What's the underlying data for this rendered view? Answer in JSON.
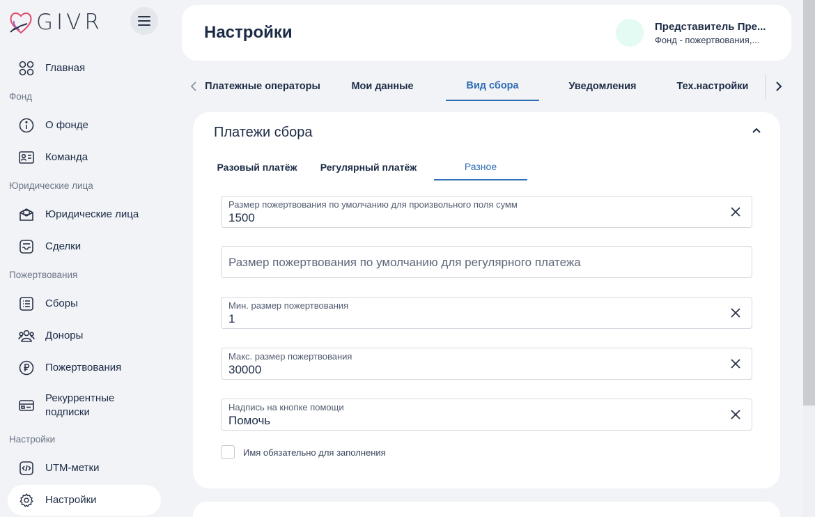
{
  "brand": {
    "name": "GIVR"
  },
  "sidebar": {
    "items": [
      {
        "label": "Главная",
        "icon": "grid-icon"
      },
      {
        "label": "О фонде",
        "icon": "info-icon"
      },
      {
        "label": "Команда",
        "icon": "id-card-icon"
      },
      {
        "label": "Юридические лица",
        "icon": "briefcase-icon"
      },
      {
        "label": "Сделки",
        "icon": "inbox-icon"
      },
      {
        "label": "Сборы",
        "icon": "list-icon"
      },
      {
        "label": "Доноры",
        "icon": "users-icon"
      },
      {
        "label": "Пожертвования",
        "icon": "ruble-icon"
      },
      {
        "label": "Рекуррентные подписки",
        "icon": "card-icon"
      },
      {
        "label": "UTM-метки",
        "icon": "code-icon"
      },
      {
        "label": "Настройки",
        "icon": "gear-icon",
        "active": true
      }
    ],
    "sections": {
      "fund": "Фонд",
      "legal": "Юридические лица",
      "donations": "Пожертвования",
      "settings": "Настройки"
    }
  },
  "header": {
    "title": "Настройки",
    "user_name": "Представитель Пре...",
    "user_org": "Фонд - пожертвования,..."
  },
  "tabs": [
    {
      "label": "Платежные операторы"
    },
    {
      "label": "Мои данные"
    },
    {
      "label": "Вид сбора",
      "active": true
    },
    {
      "label": "Уведомления"
    },
    {
      "label": "Тех.настройки"
    }
  ],
  "card": {
    "title": "Платежи сбора",
    "subtabs": [
      {
        "label": "Разовый платёж"
      },
      {
        "label": "Регулярный платёж"
      },
      {
        "label": "Разное",
        "active": true
      }
    ],
    "fields": {
      "default_amount": {
        "label": "Размер пожертвования по умолчанию для произвольного поля сумм",
        "value": "1500"
      },
      "default_regular": {
        "placeholder": "Размер пожертвования по умолчанию для регулярного платежа"
      },
      "min_amount": {
        "label": "Мин. размер пожертвования",
        "value": "1"
      },
      "max_amount": {
        "label": "Макс. размер пожертвования",
        "value": "30000"
      },
      "button_text": {
        "label": "Надпись на кнопке помощи",
        "value": "Помочь"
      }
    },
    "checkbox": {
      "label": "Имя обязательно для заполнения",
      "checked": false
    }
  },
  "colors": {
    "accent": "#2f6db5",
    "text": "#1c2b45",
    "background": "#f1f3f6",
    "avatar": "#e3fbf2"
  }
}
